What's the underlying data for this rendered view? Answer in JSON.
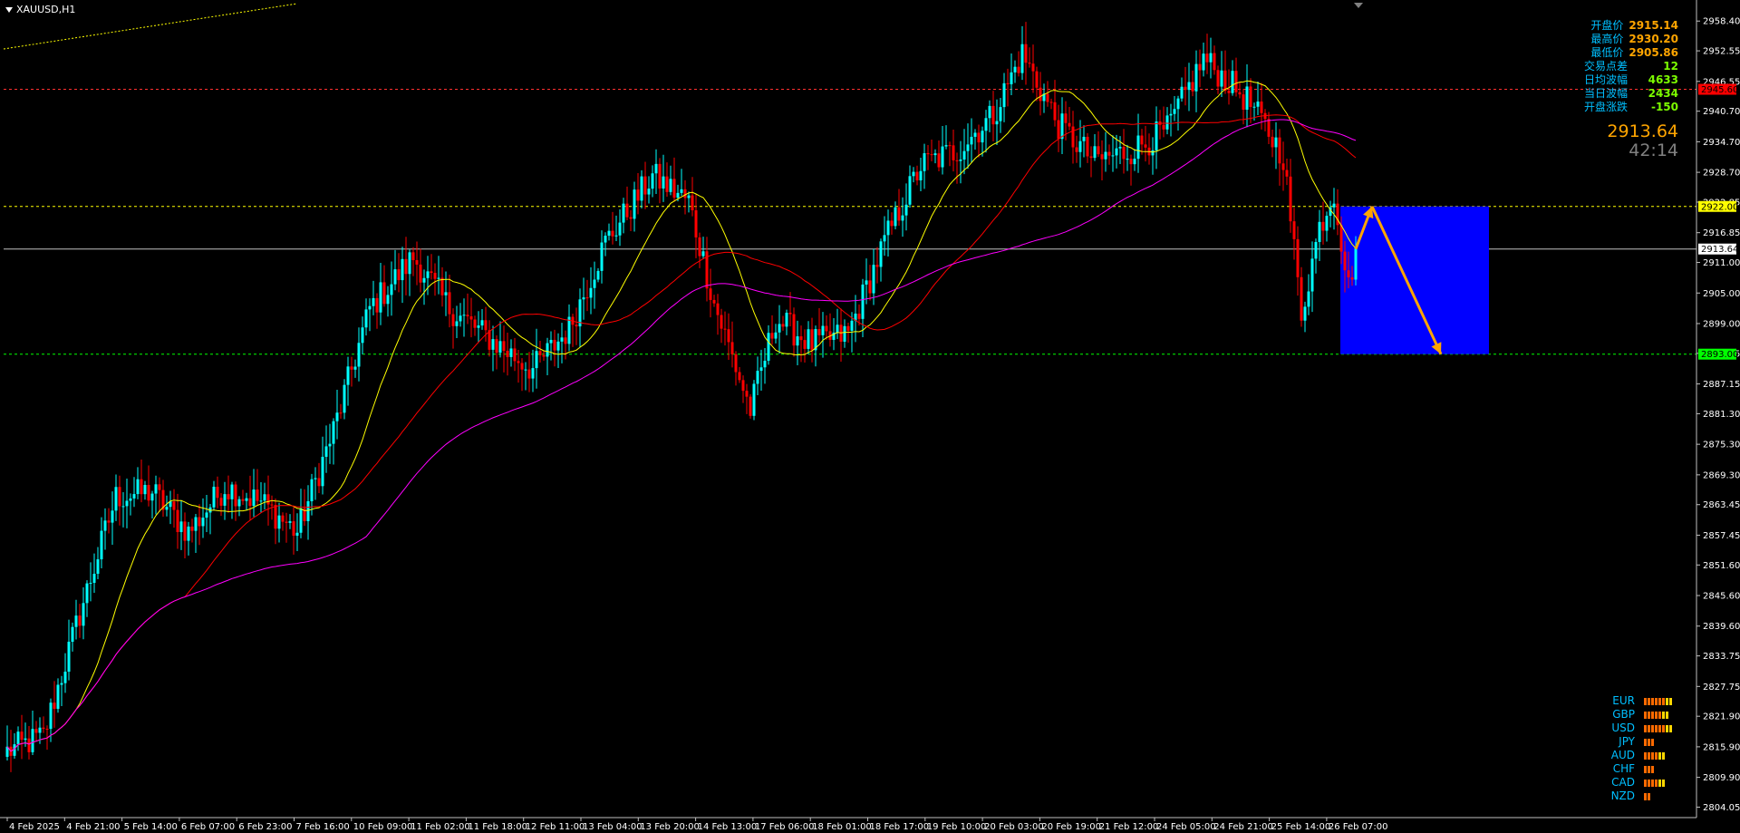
{
  "window": {
    "symbol_label": "XAUUSD,H1"
  },
  "info": {
    "rows": [
      {
        "label": "开盘价",
        "value": "2915.14",
        "color": "#ffa500"
      },
      {
        "label": "最高价",
        "value": "2930.20",
        "color": "#ffa500"
      },
      {
        "label": "最低价",
        "value": "2905.86",
        "color": "#ffa500"
      },
      {
        "label": "交易点差",
        "value": "12",
        "color": "#7cfc00"
      },
      {
        "label": "日均波幅",
        "value": "4633",
        "color": "#7cfc00"
      },
      {
        "label": "当日波幅",
        "value": "2434",
        "color": "#7cfc00"
      },
      {
        "label": "开盘涨跌",
        "value": "-150",
        "color": "#7cfc00"
      }
    ],
    "big_price": "2913.64",
    "countdown": "42:14"
  },
  "currency_strength": [
    {
      "currency": "EUR",
      "level": 8
    },
    {
      "currency": "GBP",
      "level": 7
    },
    {
      "currency": "USD",
      "level": 8
    },
    {
      "currency": "JPY",
      "level": 3
    },
    {
      "currency": "AUD",
      "level": 6
    },
    {
      "currency": "CHF",
      "level": 3
    },
    {
      "currency": "CAD",
      "level": 6
    },
    {
      "currency": "NZD",
      "level": 2
    }
  ],
  "chart_data": {
    "type": "candlestick",
    "symbol": "XAUUSD",
    "timeframe": "H1",
    "ylim": [
      2802.0,
      2962.0
    ],
    "y_ticks": [
      "2958.40",
      "2952.55",
      "2946.55",
      "2940.70",
      "2934.70",
      "2928.70",
      "2922.85",
      "2916.85",
      "2911.00",
      "2905.00",
      "2899.00",
      "2893.15",
      "2887.15",
      "2881.30",
      "2875.30",
      "2869.30",
      "2863.45",
      "2857.45",
      "2851.60",
      "2845.60",
      "2839.60",
      "2833.75",
      "2827.75",
      "2821.90",
      "2815.90",
      "2809.90",
      "2804.05"
    ],
    "x_ticks": [
      "4 Feb 2025",
      "4 Feb 21:00",
      "5 Feb 14:00",
      "6 Feb 07:00",
      "6 Feb 23:00",
      "7 Feb 16:00",
      "10 Feb 09:00",
      "11 Feb 02:00",
      "11 Feb 18:00",
      "12 Feb 11:00",
      "13 Feb 04:00",
      "13 Feb 20:00",
      "14 Feb 13:00",
      "17 Feb 06:00",
      "18 Feb 01:00",
      "18 Feb 17:00",
      "19 Feb 10:00",
      "20 Feb 03:00",
      "20 Feb 19:00",
      "21 Feb 12:00",
      "24 Feb 05:00",
      "24 Feb 21:00",
      "25 Feb 14:00",
      "26 Feb 07:00"
    ],
    "close_anchors": [
      [
        0,
        2815
      ],
      [
        10,
        2818
      ],
      [
        20,
        2842
      ],
      [
        30,
        2865
      ],
      [
        40,
        2866
      ],
      [
        50,
        2858
      ],
      [
        60,
        2867
      ],
      [
        70,
        2864
      ],
      [
        80,
        2858
      ],
      [
        90,
        2878
      ],
      [
        100,
        2902
      ],
      [
        112,
        2912
      ],
      [
        122,
        2902
      ],
      [
        135,
        2895
      ],
      [
        145,
        2890
      ],
      [
        155,
        2898
      ],
      [
        165,
        2915
      ],
      [
        178,
        2928
      ],
      [
        188,
        2923
      ],
      [
        195,
        2903
      ],
      [
        205,
        2882
      ],
      [
        212,
        2900
      ],
      [
        222,
        2895
      ],
      [
        232,
        2897
      ],
      [
        242,
        2915
      ],
      [
        252,
        2930
      ],
      [
        262,
        2933
      ],
      [
        272,
        2940
      ],
      [
        280,
        2952
      ],
      [
        290,
        2938
      ],
      [
        300,
        2931
      ],
      [
        310,
        2933
      ],
      [
        320,
        2937
      ],
      [
        330,
        2951
      ],
      [
        342,
        2943
      ],
      [
        352,
        2932
      ],
      [
        357,
        2901
      ],
      [
        362,
        2918
      ],
      [
        366,
        2925
      ],
      [
        370,
        2906
      ],
      [
        372,
        2914
      ]
    ],
    "candle_count": 373,
    "moving_averages": [
      {
        "period": 20,
        "color": "#ffff00"
      },
      {
        "period": 50,
        "color": "#ff0000"
      },
      {
        "period": 100,
        "color": "#ff00ff"
      }
    ],
    "bull_color": "#00ffff",
    "bear_color": "#ff0000",
    "horizontal_lines": [
      {
        "price": 2945.0,
        "label": "2945.60",
        "color": "#ff3030",
        "style": "dash",
        "label_bg": "#ff0000"
      },
      {
        "price": 2922.0,
        "label": "2922.00",
        "color": "#ffff00",
        "style": "dash",
        "label_bg": "#ffff00"
      },
      {
        "price": 2913.64,
        "label": "2913.64",
        "color": "#c0c0c0",
        "style": "solid",
        "label_bg": "#ffffff"
      },
      {
        "price": 2893.0,
        "label": "2893.00",
        "color": "#00ff00",
        "style": "dash",
        "label_bg": "#00ff00"
      }
    ],
    "projection_box": {
      "price_top": 2922.0,
      "price_bottom": 2893.0,
      "color": "#0000ff"
    },
    "projection_arrows": [
      {
        "from_price": 2913.64,
        "to_price": 2922.0,
        "color": "#ffa500"
      },
      {
        "from_price": 2922.0,
        "to_price": 2893.0,
        "color": "#ffa500"
      }
    ]
  }
}
